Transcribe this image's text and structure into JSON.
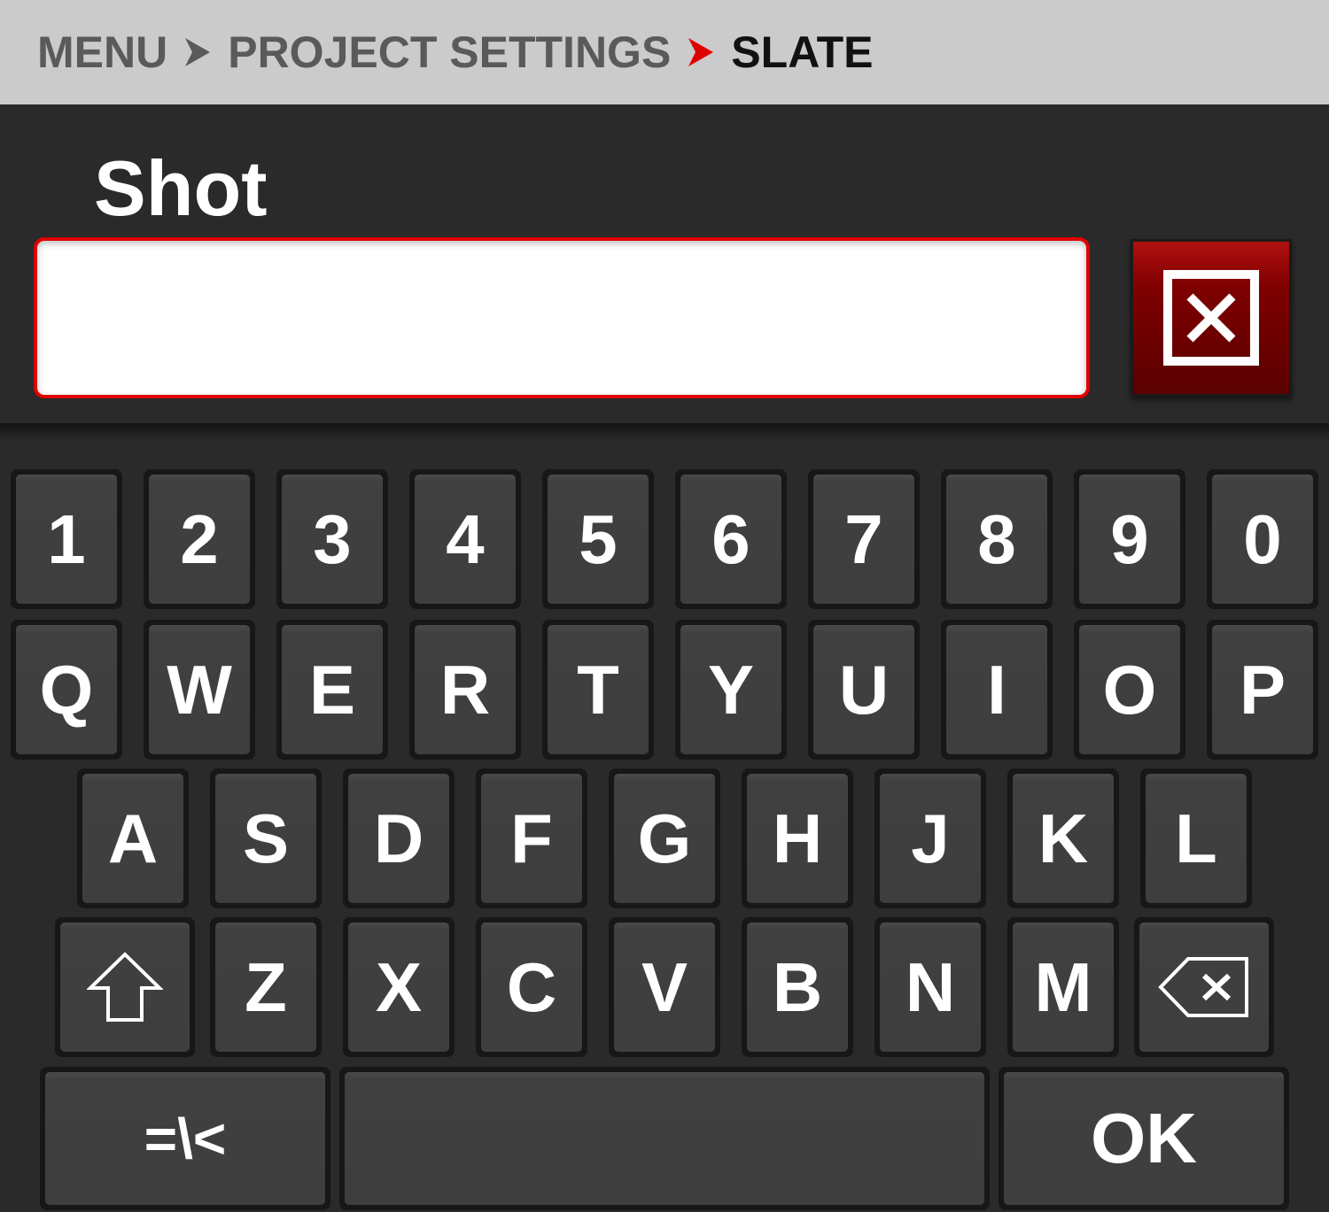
{
  "breadcrumb": {
    "items": [
      "MENU",
      "PROJECT SETTINGS",
      "SLATE"
    ]
  },
  "colors": {
    "accent": "#e10000",
    "clear_button": "#7e0000",
    "background": "#2a2a2a",
    "key_face": "#3e3e3e",
    "header_bg": "#cbcbcb"
  },
  "field": {
    "label": "Shot",
    "value": "",
    "clear_icon": "close-box-icon"
  },
  "keyboard": {
    "row1": [
      "1",
      "2",
      "3",
      "4",
      "5",
      "6",
      "7",
      "8",
      "9",
      "0"
    ],
    "row2": [
      "Q",
      "W",
      "E",
      "R",
      "T",
      "Y",
      "U",
      "I",
      "O",
      "P"
    ],
    "row3": [
      "A",
      "S",
      "D",
      "F",
      "G",
      "H",
      "J",
      "K",
      "L"
    ],
    "row4": [
      "Z",
      "X",
      "C",
      "V",
      "B",
      "N",
      "M"
    ],
    "shift_icon": "shift-arrow-icon",
    "backspace_icon": "backspace-icon",
    "symbols_label": "=\\<",
    "space_label": "",
    "ok_label": "OK"
  }
}
